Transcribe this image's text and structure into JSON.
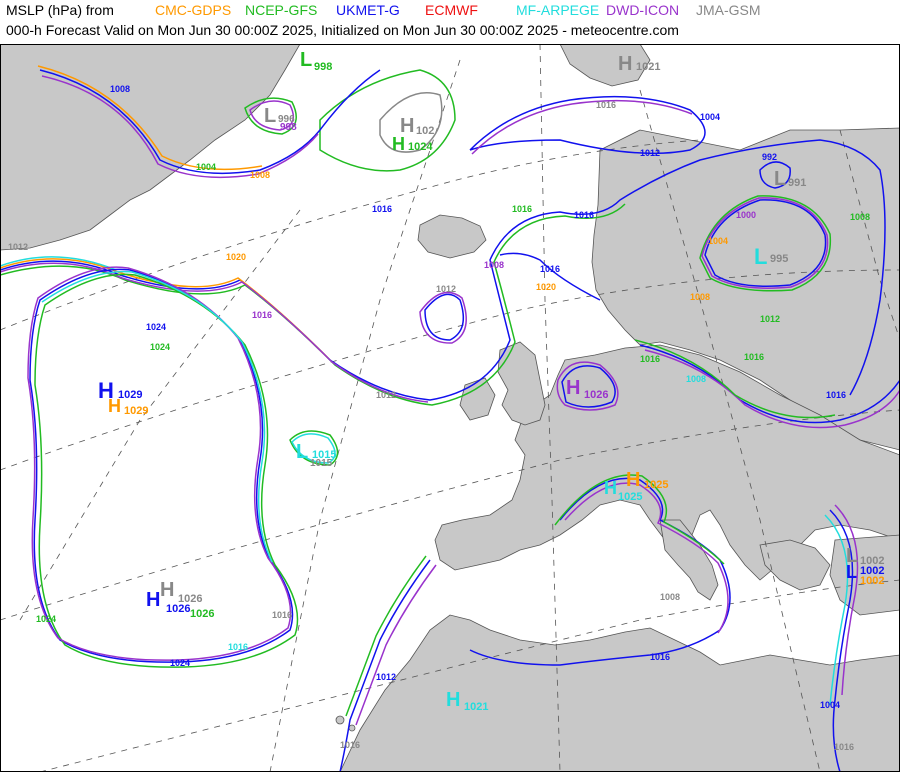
{
  "header": {
    "prefix": "MSLP (hPa) from",
    "subtitle": "000-h Forecast Valid on Mon Jun 30 00:00Z 2025, Initialized on Mon Jun 30 00:00Z 2025 - meteocentre.com"
  },
  "models": [
    {
      "name": "CMC-GDPS",
      "color": "#ff9900"
    },
    {
      "name": "NCEP-GFS",
      "color": "#22bb22"
    },
    {
      "name": "UKMET-G",
      "color": "#1111ee"
    },
    {
      "name": "ECMWF",
      "color": "#ee1111"
    },
    {
      "name": "MF-ARPEGE",
      "color": "#22dddd"
    },
    {
      "name": "DWD-ICON",
      "color": "#9933cc"
    },
    {
      "name": "JMA-GSM",
      "color": "#888888"
    }
  ],
  "colors": {
    "land": "#c8c8c8",
    "sea": "#ffffff",
    "coast": "#555555",
    "grid": "#555555"
  },
  "pressure_centers": [
    {
      "type": "H",
      "value": "1029",
      "color": "#1111ee"
    },
    {
      "type": "H",
      "value": "1029",
      "color": "#ff9900"
    },
    {
      "type": "H",
      "value": "1026",
      "color": "#1111ee"
    },
    {
      "type": "H",
      "value": "1026",
      "color": "#888888"
    },
    {
      "type": "H",
      "value": "1026",
      "color": "#22bb22"
    },
    {
      "type": "L",
      "value": "1015",
      "color": "#22dddd"
    },
    {
      "type": "L",
      "value": "1015",
      "color": "#888888"
    },
    {
      "type": "H",
      "value": "1024",
      "color": "#22bb22"
    },
    {
      "type": "H",
      "value": "102",
      "color": "#888888"
    },
    {
      "type": "L",
      "value": "998",
      "color": "#22bb22"
    },
    {
      "type": "L",
      "value": "996",
      "color": "#888888"
    },
    {
      "type": "L",
      "value": "998",
      "color": "#9933cc"
    },
    {
      "type": "H",
      "value": "1021",
      "color": "#888888"
    },
    {
      "type": "L",
      "value": "991",
      "color": "#888888"
    },
    {
      "type": "L",
      "value": "995",
      "color": "#22dddd"
    },
    {
      "type": "H",
      "value": "1026",
      "color": "#9933cc"
    },
    {
      "type": "H",
      "value": "1025",
      "color": "#ff9900"
    },
    {
      "type": "H",
      "value": "1025",
      "color": "#22dddd"
    },
    {
      "type": "L",
      "value": "1002",
      "color": "#888888"
    },
    {
      "type": "L",
      "value": "1002",
      "color": "#1111ee"
    },
    {
      "type": "L",
      "value": "1002",
      "color": "#ff9900"
    },
    {
      "type": "H",
      "value": "1021",
      "color": "#22dddd"
    }
  ],
  "isobar_labels": [
    "1008",
    "1008",
    "1004",
    "1012",
    "1016",
    "1016",
    "1024",
    "1020",
    "1024",
    "1016",
    "1012",
    "1012",
    "1016",
    "1016",
    "1020",
    "1008",
    "1016",
    "1012",
    "1024",
    "1024",
    "1016",
    "1008",
    "1008",
    "1004",
    "1016",
    "1012",
    "1016",
    "992",
    "1000",
    "1004",
    "1016",
    "1008",
    "1012",
    "1016",
    "1008",
    "1016",
    "1016",
    "1004",
    "1016"
  ]
}
